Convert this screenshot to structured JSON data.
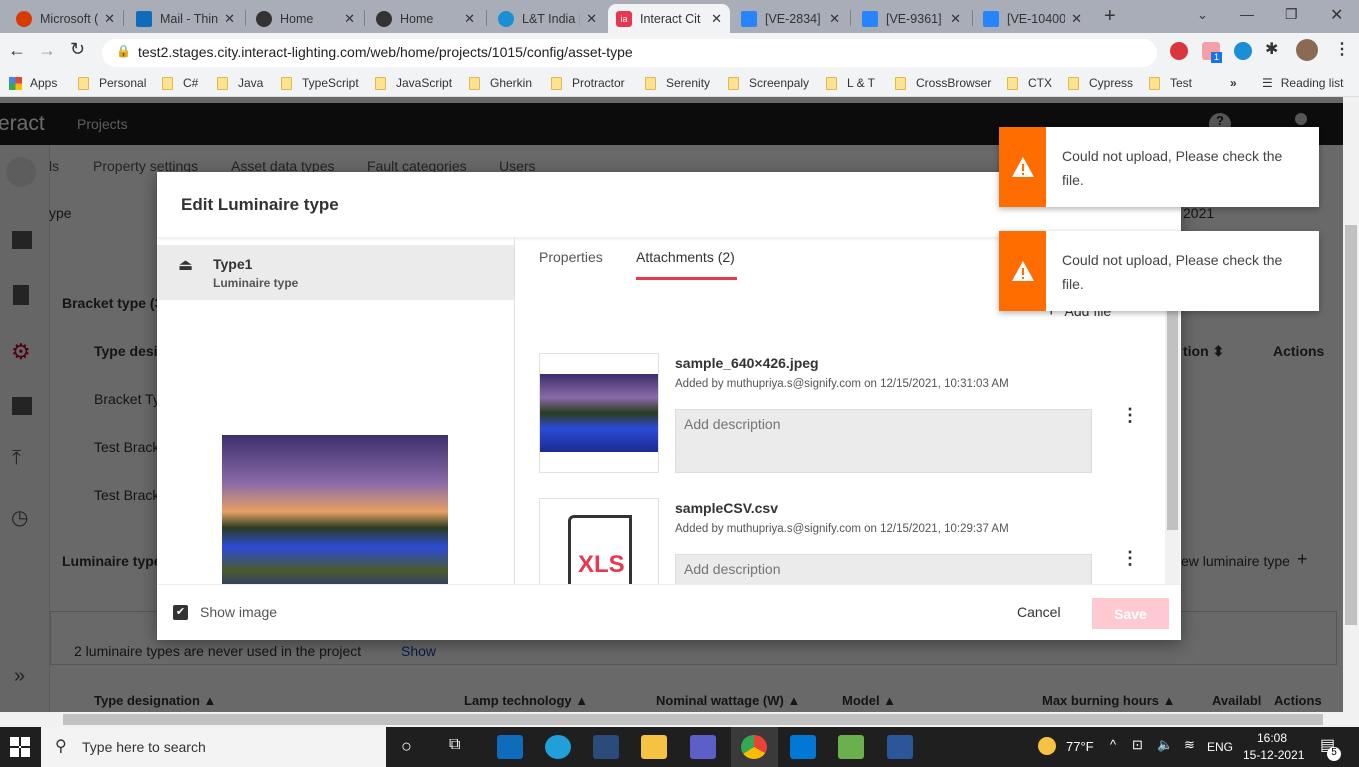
{
  "browser": {
    "tabs": [
      {
        "label": "Microsoft (",
        "icon": "office-icon",
        "color": "#d83b01"
      },
      {
        "label": "Mail - Thin",
        "icon": "outlook-icon",
        "color": "#0f6cbd"
      },
      {
        "label": "Home",
        "icon": "globe-icon",
        "color": "#333"
      },
      {
        "label": "Home",
        "icon": "globe-icon",
        "color": "#333"
      },
      {
        "label": "L&T India |",
        "icon": "lt-icon",
        "color": "#1a8fd6"
      },
      {
        "label": "Interact Cit",
        "icon": "interact-icon",
        "color": "#e8384f",
        "active": true
      },
      {
        "label": "[VE-2834] /",
        "icon": "jira-icon",
        "color": "#2684ff"
      },
      {
        "label": "[VE-9361] /",
        "icon": "jira-icon",
        "color": "#2684ff"
      },
      {
        "label": "[VE-10400]",
        "icon": "jira-icon",
        "color": "#2684ff"
      }
    ],
    "url": "test2.stages.city.interact-lighting.com/web/home/projects/1015/config/asset-type",
    "bookmarks": [
      "Apps",
      "Personal",
      "C#",
      "Java",
      "TypeScript",
      "JavaScript",
      "Gherkin",
      "Protractor",
      "Serenity",
      "Screenpaly",
      "L & T",
      "CrossBrowser",
      "CTX",
      "Cypress",
      "Test"
    ],
    "reading_list": "Reading list",
    "extension_badge": "1"
  },
  "app": {
    "logo": "eract",
    "nav_projects": "Projects",
    "config_tabs": [
      "ls",
      "Property settings",
      "Asset data types",
      "Fault categories",
      "Users"
    ],
    "bg": {
      "type_text": "ype",
      "date_text": "2021",
      "bracket_title": "Bracket type (3",
      "type_desig": "Type desi",
      "bracket_rows": [
        "Bracket Ty",
        "Test Brack",
        "Test Brack"
      ],
      "col_tion": "tion ⬍",
      "actions": "Actions",
      "luminaire_title": "Luminaire type",
      "new_luminaire": "ew luminaire type",
      "unused_text": "2 luminaire types are never used in the project",
      "show_link": "Show",
      "bottom_cols": [
        "Type designation ▲",
        "Lamp technology ▲",
        "Nominal wattage (W) ▲",
        "Model ▲",
        "Max burning hours ▲",
        "Availabl",
        "Actions"
      ]
    }
  },
  "modal": {
    "title": "Edit Luminaire type",
    "item_name": "Type1",
    "item_sub": "Luminaire type",
    "tabs": [
      "Properties",
      "Attachments (2)"
    ],
    "active_tab": 1,
    "add_file": "Add file",
    "attachments": [
      {
        "name": "sample_640×426.jpeg",
        "meta": "Added by muthupriya.s@signify.com on 12/15/2021, 10:31:03 AM",
        "placeholder": "Add description"
      },
      {
        "name": "sampleCSV.csv",
        "meta": "Added by muthupriya.s@signify.com on 12/15/2021, 10:29:37 AM",
        "placeholder": "Add description",
        "file_label": "XLS"
      }
    ],
    "show_image": "Show image",
    "show_image_checked": true,
    "cancel": "Cancel",
    "save": "Save",
    "accent": "#e8384f"
  },
  "toasts": [
    {
      "message": "Could not upload, Please check the file.",
      "color": "#ff6d00"
    },
    {
      "message": "Could not upload, Please check the file.",
      "color": "#ff6d00"
    }
  ],
  "taskbar": {
    "search_placeholder": "Type here to search",
    "weather": "77°F",
    "lang": "ENG",
    "time": "16:08",
    "date": "15-12-2021",
    "notifications": "5"
  }
}
